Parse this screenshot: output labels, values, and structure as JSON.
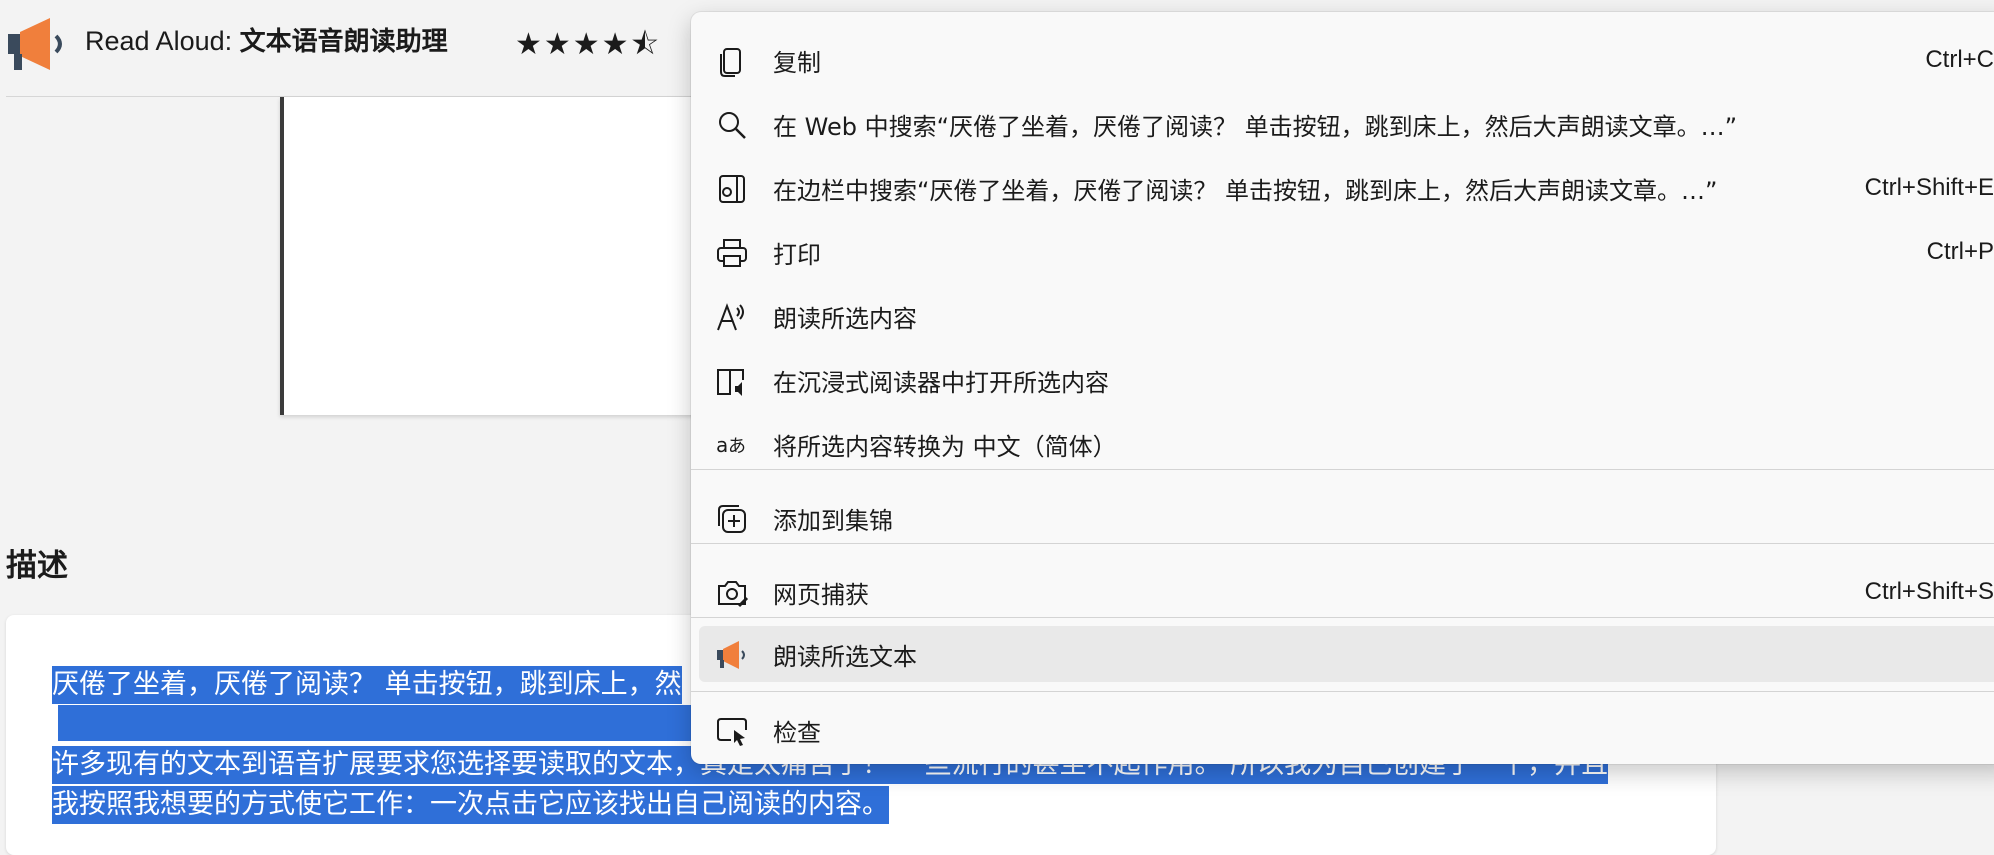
{
  "header": {
    "app_name": "Read Aloud: ",
    "app_subtitle": "文本语音朗读助理",
    "rating_stars": "★★★★⯪",
    "icon": "megaphone-icon"
  },
  "description": {
    "heading": "描述",
    "line1": "厌倦了坐着，厌倦了阅读？ 单击按钮，跳到床上，然",
    "line2": "许多现有的文本到语音扩展要求您选择要读取的文本，真是太痛苦了！ 一些流行的甚至不起作用。 所以我为自己创建了一个，并且",
    "line3": "我按照我想要的方式使它工作：一次点击它应该找出自己阅读的内容。"
  },
  "context_menu": {
    "items": [
      {
        "label": "复制",
        "shortcut": "Ctrl+C",
        "icon": "copy-icon"
      },
      {
        "label": "在 Web 中搜索“厌倦了坐着，厌倦了阅读？ 单击按钮，跳到床上，然后大声朗读文章。…”",
        "shortcut": "",
        "icon": "search-icon"
      },
      {
        "label": "在边栏中搜索“厌倦了坐着，厌倦了阅读？ 单击按钮，跳到床上，然后大声朗读文章。…”",
        "shortcut": "Ctrl+Shift+E",
        "icon": "sidebar-search-icon"
      },
      {
        "label": "打印",
        "shortcut": "Ctrl+P",
        "icon": "printer-icon"
      },
      {
        "label": "朗读所选内容",
        "shortcut": "",
        "icon": "read-aloud-icon"
      },
      {
        "label": "在沉浸式阅读器中打开所选内容",
        "shortcut": "",
        "icon": "immersive-reader-icon"
      },
      {
        "label": "将所选内容转换为 中文（简体）",
        "shortcut": "",
        "icon": "translate-icon"
      },
      {
        "label": "添加到集锦",
        "shortcut": "",
        "icon": "collections-icon"
      },
      {
        "label": "网页捕获",
        "shortcut": "Ctrl+Shift+S",
        "icon": "web-capture-icon"
      },
      {
        "label": "朗读所选文本",
        "shortcut": "",
        "icon": "megaphone-icon"
      },
      {
        "label": "检查",
        "shortcut": "",
        "icon": "inspect-icon"
      }
    ]
  },
  "colors": {
    "selection": "#2f6fd8",
    "menu_bg": "#f9f9f9",
    "hover_bg": "#e9e9e9",
    "brand_orange": "#f07f3c"
  }
}
